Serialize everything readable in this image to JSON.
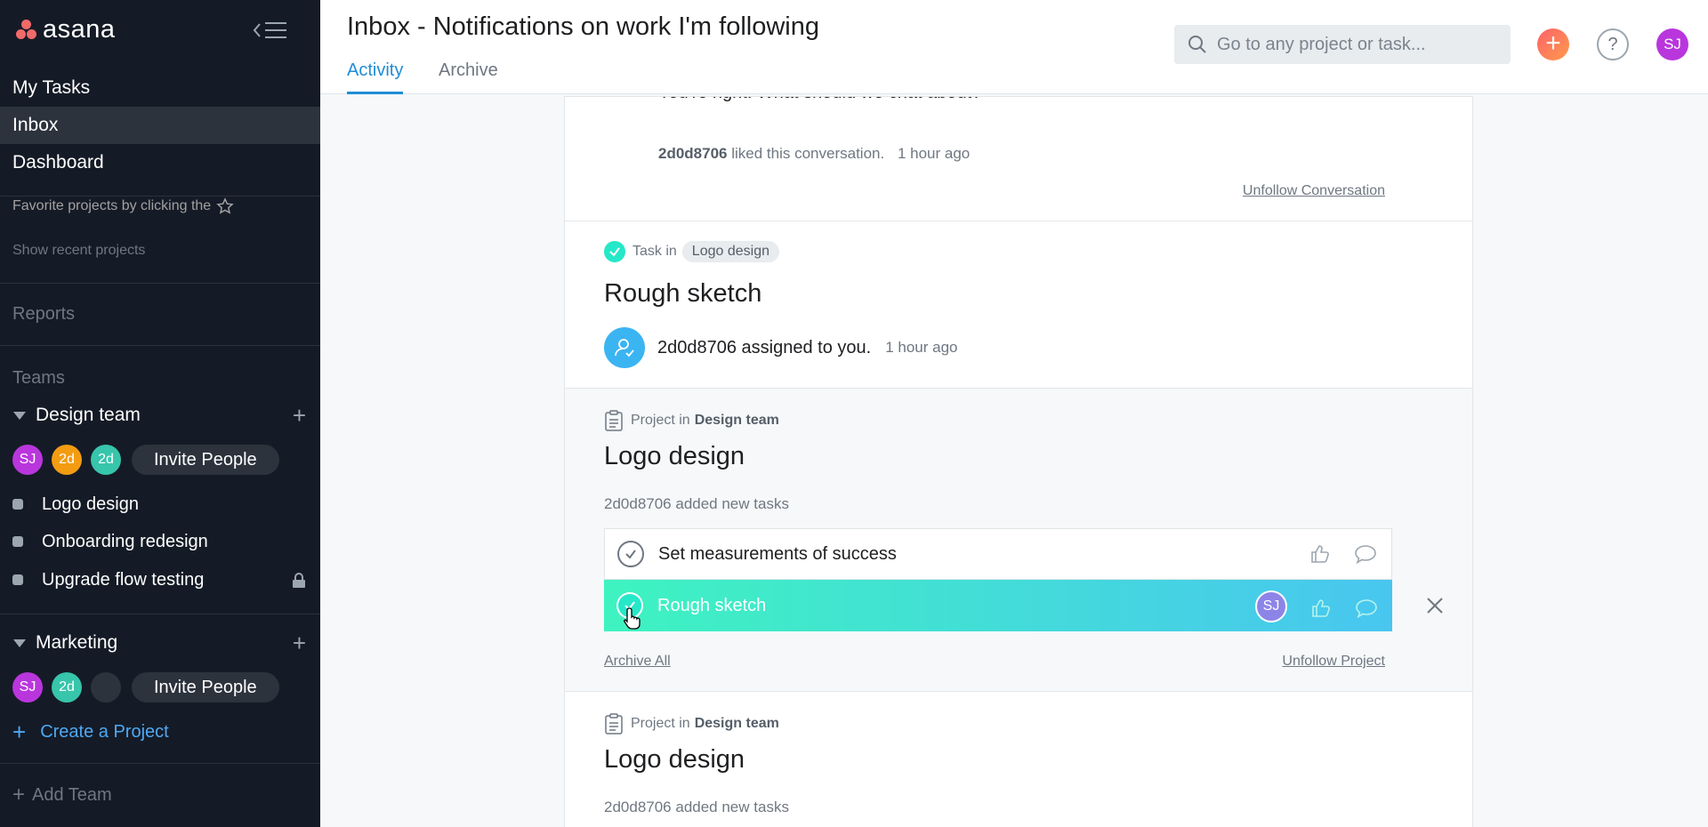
{
  "sidebar": {
    "logo_text": "asana",
    "nav": [
      {
        "label": "My Tasks"
      },
      {
        "label": "Inbox"
      },
      {
        "label": "Dashboard"
      }
    ],
    "favorites_hint": "Favorite projects by clicking the",
    "show_recent": "Show recent projects",
    "reports": "Reports",
    "teams_label": "Teams",
    "teams": [
      {
        "name": "Design team",
        "members": [
          "SJ",
          "2d",
          "2d"
        ],
        "invite_label": "Invite People",
        "projects": [
          {
            "name": "Logo design"
          },
          {
            "name": "Onboarding redesign"
          },
          {
            "name": "Upgrade flow testing"
          }
        ]
      },
      {
        "name": "Marketing",
        "members": [
          "SJ",
          "2d",
          ""
        ],
        "invite_label": "Invite People"
      }
    ],
    "create_project": "Create a Project",
    "add_team": "Add Team"
  },
  "topbar": {
    "title": "Inbox - Notifications on work I'm following",
    "tabs": [
      {
        "label": "Activity",
        "active": true
      },
      {
        "label": "Archive",
        "active": false
      }
    ],
    "search_placeholder": "Go to any project or task...",
    "plus_label": "+",
    "help_label": "?",
    "user_initials": "SJ"
  },
  "feed": {
    "card1": {
      "cut_text": "You're right. What should we chat about?",
      "liked_user": "2d0d8706",
      "liked_text": "liked this conversation.",
      "time": "1 hour ago",
      "unfollow": "Unfollow Conversation"
    },
    "card2": {
      "meta_prefix": "Task in",
      "project": "Logo design",
      "title": "Rough sketch",
      "assign_text": "2d0d8706 assigned to you.",
      "time": "1 hour ago"
    },
    "card3": {
      "meta_prefix": "Project in",
      "team": "Design team",
      "title": "Logo design",
      "subtitle": "2d0d8706 added new tasks",
      "tasks": [
        {
          "name": "Set measurements of success"
        },
        {
          "name": "Rough sketch",
          "assignee": "SJ"
        }
      ],
      "archive_all": "Archive All",
      "unfollow": "Unfollow Project"
    },
    "card4": {
      "meta_prefix": "Project in",
      "team": "Design team",
      "title": "Logo design",
      "subtitle": "2d0d8706 added new tasks"
    }
  },
  "colors": {
    "sidebar_bg": "#151b26",
    "accent_blue": "#1f8dd6",
    "task_gradient_start": "#3ef3c0",
    "task_gradient_end": "#48c6f0",
    "avatar_sj": "#b936dd",
    "avatar_2d_orange": "#f39c12",
    "avatar_2d_green": "#37c5ab"
  }
}
